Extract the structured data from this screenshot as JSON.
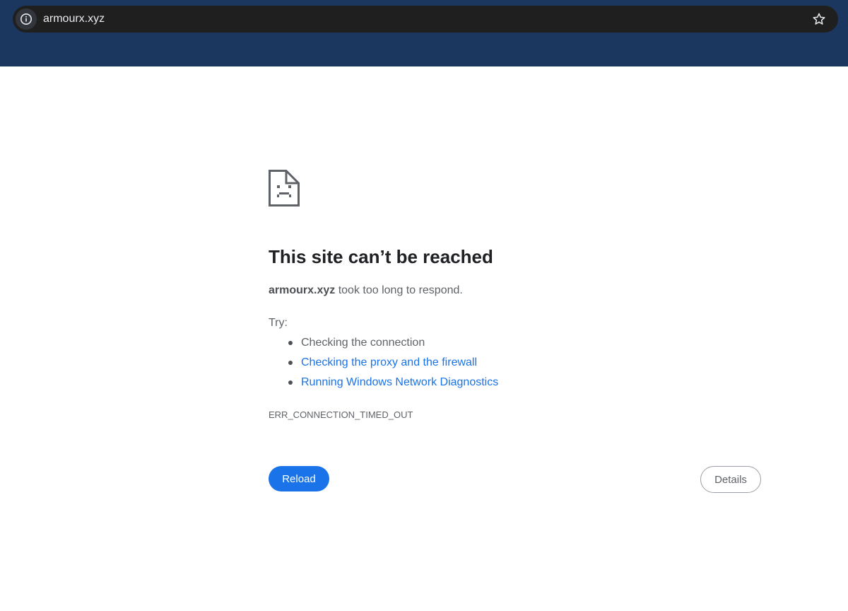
{
  "browser": {
    "url": "armourx.xyz",
    "site_info_icon": "info-icon",
    "bookmark_icon": "star-outline-icon"
  },
  "error_page": {
    "icon": "sad-page-icon",
    "title": "This site can’t be reached",
    "summary_host": "armourx.xyz",
    "summary_rest": " took too long to respond.",
    "try_label": "Try:",
    "suggestions": [
      {
        "label": "Checking the connection",
        "is_link": false
      },
      {
        "label": "Checking the proxy and the firewall",
        "is_link": true
      },
      {
        "label": "Running Windows Network Diagnostics",
        "is_link": true
      }
    ],
    "error_code": "ERR_CONNECTION_TIMED_OUT",
    "reload_label": "Reload",
    "details_label": "Details"
  },
  "colors": {
    "header_bg": "#1b3760",
    "address_bar_bg": "#1f1f1f",
    "link": "#1a73e8",
    "primary_button": "#1a73e8",
    "title_text": "#202124",
    "body_text": "#5f6368"
  }
}
